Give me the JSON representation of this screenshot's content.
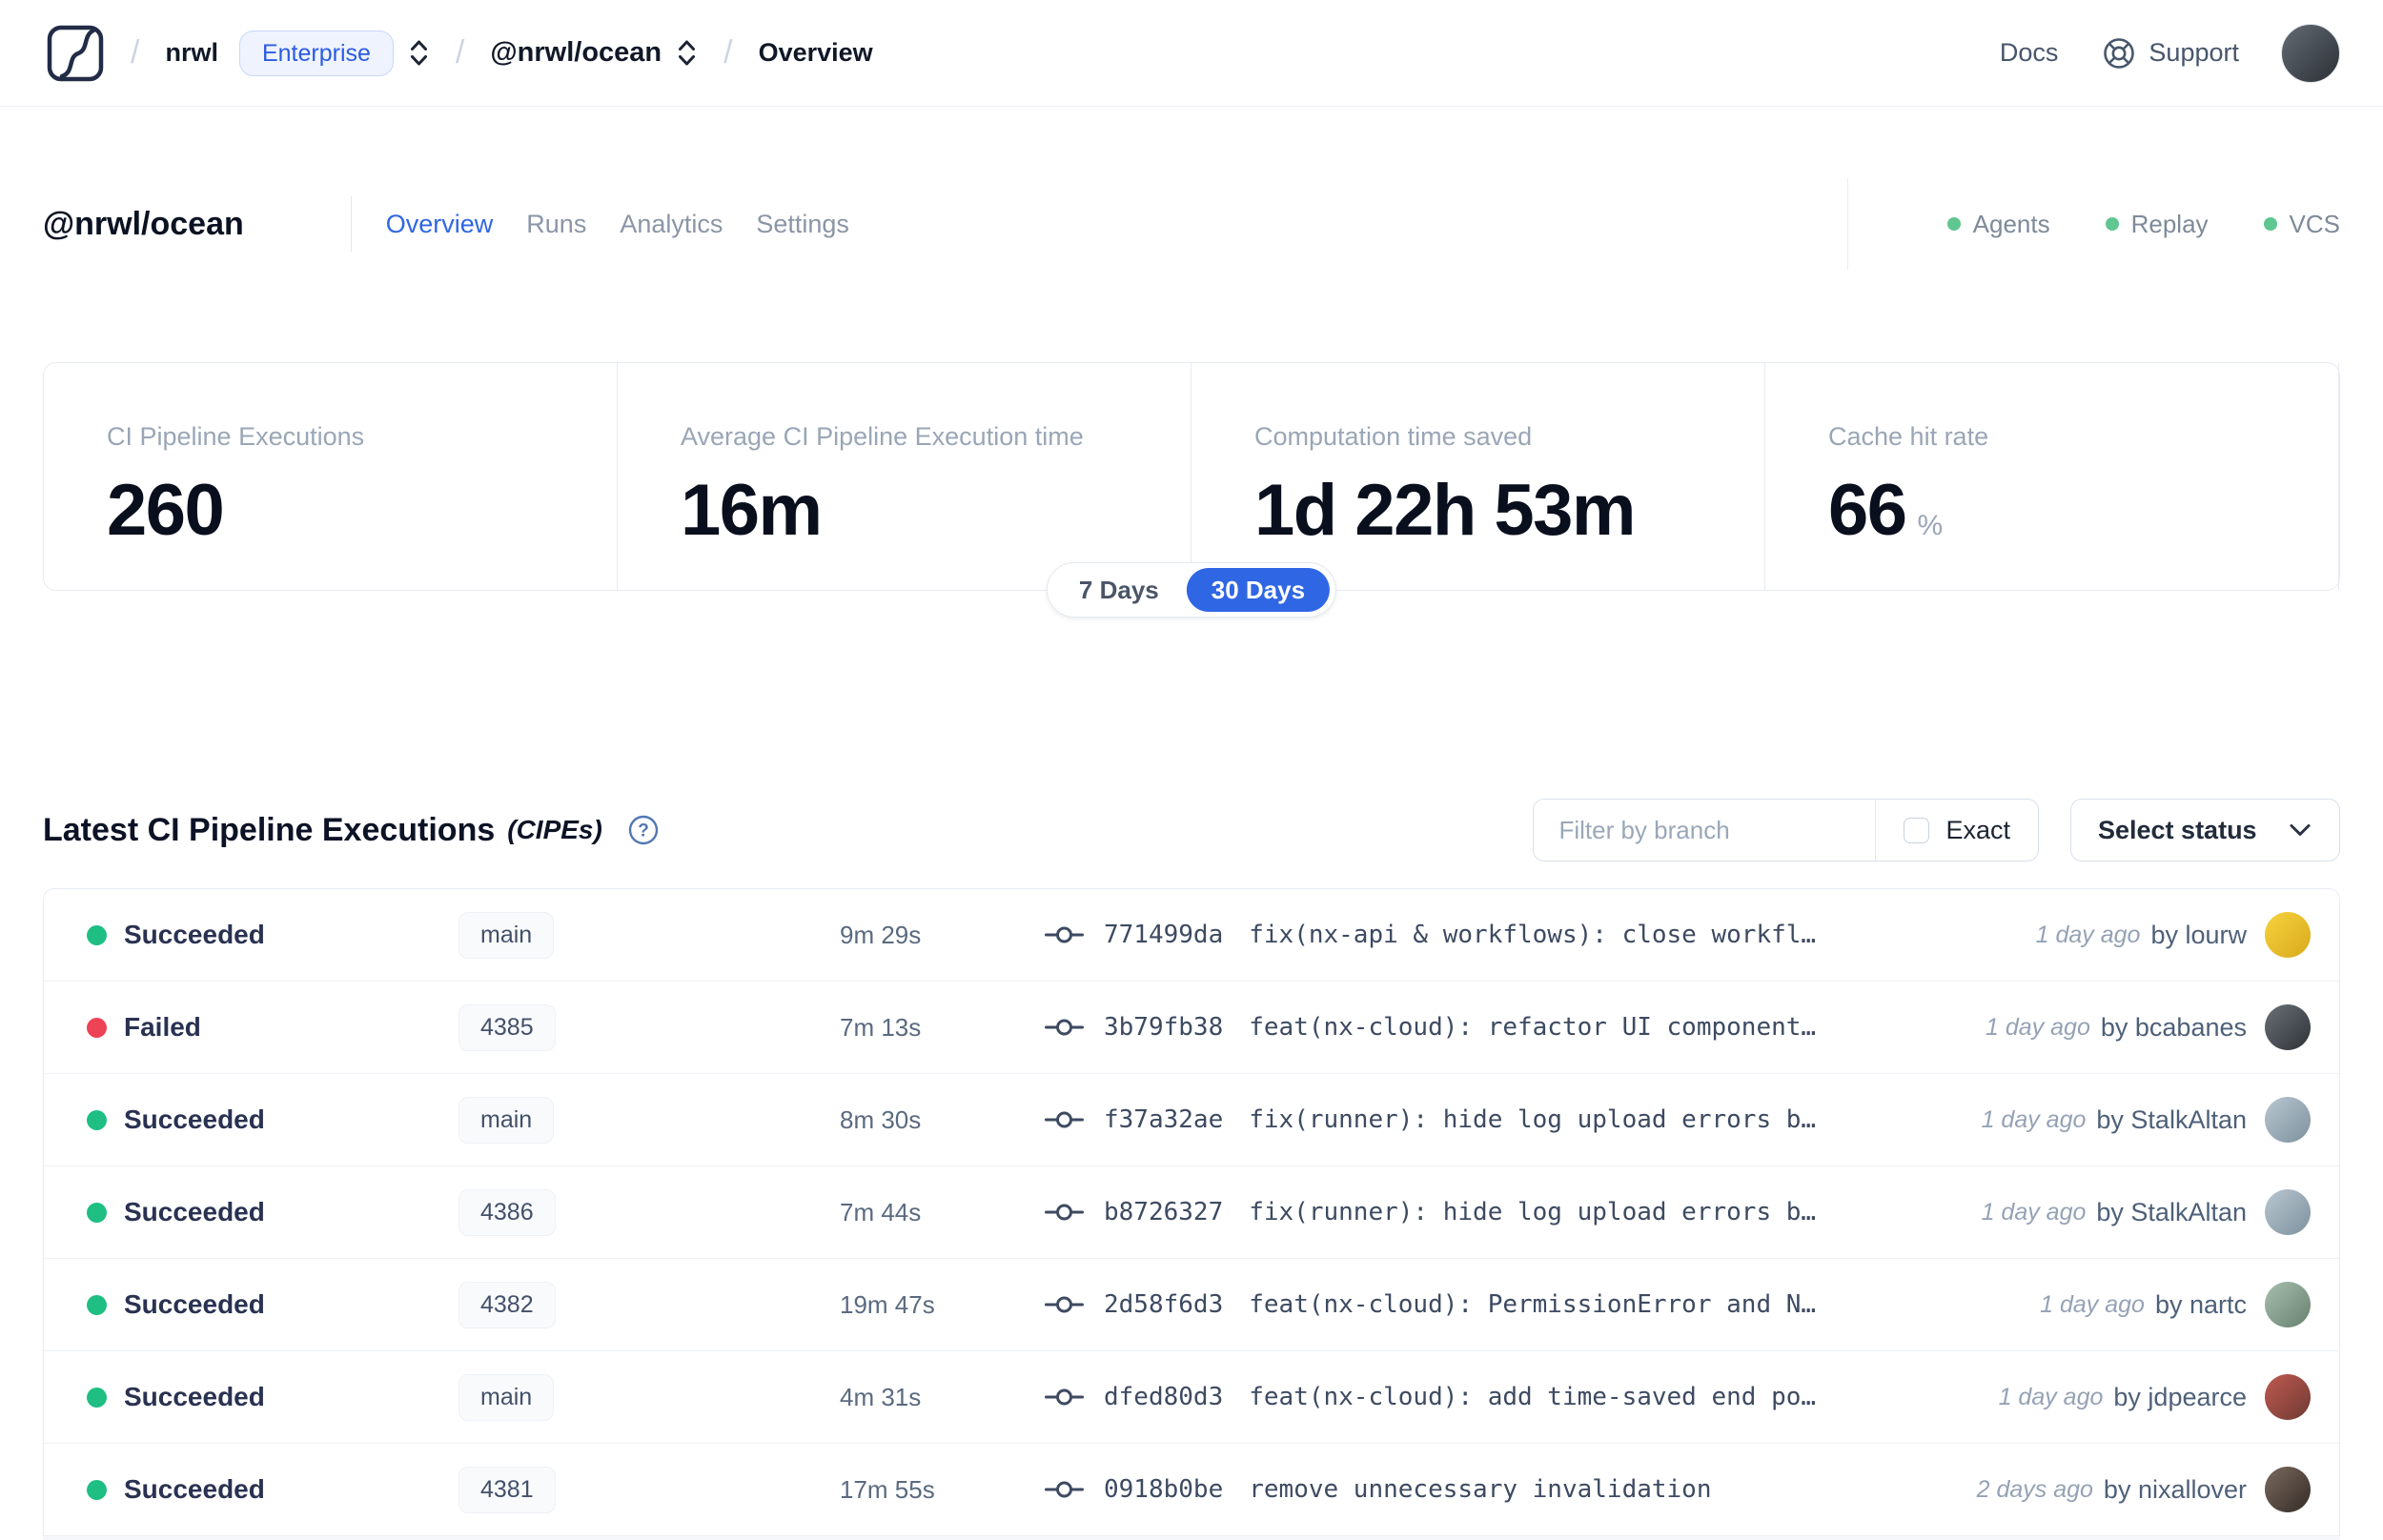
{
  "colors": {
    "accent_blue": "#2f66e4",
    "success_green": "#1fbe83",
    "failure_red": "#ee4256",
    "integration_green": "#5fc78f"
  },
  "topnav": {
    "breadcrumb": {
      "org": "nrwl",
      "org_badge": "Enterprise",
      "workspace": "@nrwl/ocean",
      "page": "Overview"
    },
    "docs_label": "Docs",
    "support_label": "Support",
    "avatar_colors": [
      "#646b73",
      "#2b3036"
    ]
  },
  "workspace_header": {
    "title": "@nrwl/ocean",
    "tabs": [
      {
        "label": "Overview",
        "active": true
      },
      {
        "label": "Runs",
        "active": false
      },
      {
        "label": "Analytics",
        "active": false
      },
      {
        "label": "Settings",
        "active": false
      }
    ],
    "integrations": [
      {
        "label": "Agents"
      },
      {
        "label": "Replay"
      },
      {
        "label": "VCS"
      }
    ]
  },
  "stats": {
    "cards": [
      {
        "label": "CI Pipeline Executions",
        "value": "260"
      },
      {
        "label": "Average CI Pipeline Execution time",
        "value": "16m"
      },
      {
        "label": "Computation time saved",
        "value": "1d 22h 53m"
      },
      {
        "label": "Cache hit rate",
        "value": "66",
        "suffix": "%"
      }
    ]
  },
  "range_toggle": {
    "options": [
      {
        "label": "7 Days",
        "active": false
      },
      {
        "label": "30 Days",
        "active": true
      }
    ]
  },
  "cipe_section": {
    "title": "Latest CI Pipeline Executions",
    "title_suffix": "(CIPEs)",
    "filter_placeholder": "Filter by branch",
    "exact_label": "Exact",
    "status_select_label": "Select status",
    "rows": [
      {
        "status": "Succeeded",
        "status_color": "success_green",
        "branch": "main",
        "duration": "9m 29s",
        "commit_hash": "771499da",
        "commit_message": "fix(nx-api & workflows): close workfl…",
        "time_ago": "1 day ago",
        "author": "by lourw",
        "avatar_colors": [
          "#f6d33e",
          "#d9a91c"
        ]
      },
      {
        "status": "Failed",
        "status_color": "failure_red",
        "branch": "4385",
        "duration": "7m 13s",
        "commit_hash": "3b79fb38",
        "commit_message": "feat(nx-cloud): refactor UI component…",
        "time_ago": "1 day ago",
        "author": "by bcabanes",
        "avatar_colors": [
          "#6b7077",
          "#2e3338"
        ]
      },
      {
        "status": "Succeeded",
        "status_color": "success_green",
        "branch": "main",
        "duration": "8m 30s",
        "commit_hash": "f37a32ae",
        "commit_message": "fix(runner): hide log upload errors b…",
        "time_ago": "1 day ago",
        "author": "by StalkAltan",
        "avatar_colors": [
          "#b9c7d1",
          "#7d919e"
        ]
      },
      {
        "status": "Succeeded",
        "status_color": "success_green",
        "branch": "4386",
        "duration": "7m 44s",
        "commit_hash": "b8726327",
        "commit_message": "fix(runner): hide log upload errors b…",
        "time_ago": "1 day ago",
        "author": "by StalkAltan",
        "avatar_colors": [
          "#b9c7d1",
          "#7d919e"
        ]
      },
      {
        "status": "Succeeded",
        "status_color": "success_green",
        "branch": "4382",
        "duration": "19m 47s",
        "commit_hash": "2d58f6d3",
        "commit_message": "feat(nx-cloud): PermissionError and N…",
        "time_ago": "1 day ago",
        "author": "by nartc",
        "avatar_colors": [
          "#a8bfae",
          "#67816f"
        ]
      },
      {
        "status": "Succeeded",
        "status_color": "success_green",
        "branch": "main",
        "duration": "4m 31s",
        "commit_hash": "dfed80d3",
        "commit_message": "feat(nx-cloud): add time-saved end po…",
        "time_ago": "1 day ago",
        "author": "by jdpearce",
        "avatar_colors": [
          "#c05a50",
          "#6e3a34"
        ]
      },
      {
        "status": "Succeeded",
        "status_color": "success_green",
        "branch": "4381",
        "duration": "17m 55s",
        "commit_hash": "0918b0be",
        "commit_message": "remove unnecessary invalidation",
        "time_ago": "2 days ago",
        "author": "by nixallover",
        "avatar_colors": [
          "#7a6a5f",
          "#352c26"
        ]
      }
    ]
  }
}
